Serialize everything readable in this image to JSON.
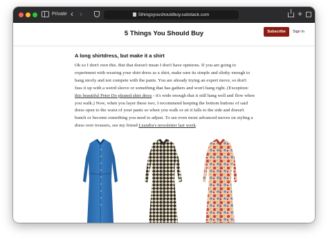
{
  "browser": {
    "private_label": "Private",
    "back_glyph": "‹",
    "forward_glyph": "›",
    "url": "5thingsyoushouldbuy.substack.com",
    "new_tab_glyph": "+"
  },
  "site": {
    "title": "5 Things You Should Buy",
    "subscribe_label": "Subscribe",
    "signin_label": "Sign in",
    "accent_color": "#8c1d10"
  },
  "article": {
    "heading": "A long shirtdress, but make it a shirt",
    "p1": "Ok so I don't own this. But that doesn't mean I don't have opinions. If you are going to experiment with wearing your shirt dress as a shirt, make sure its simple and slinky enough to hang nicely and not compete with the pants. You are already trying an expert move, so don't fuss it up with a weird sleeve or something that has gathers and won't hang right. (Exception: ",
    "link1": "this beautiful Peter Do pleated shirt dress",
    "p2": " - it's wide enough that it still hang well and flow when you walk.) Now, when you layer these two, I recommend keeping the bottom buttons of said dress open to the waist of your pants so when you walk or sit it falls to the side and doesn't bunch or become something you need to adjust. To see even more advanced moves on styling a dress over trousers, see my friend ",
    "link2": "Leandra's newsletter last week",
    "p3": "."
  },
  "products": [
    {
      "name": "blue-denim-shirtdress",
      "color": "#2f6fb0"
    },
    {
      "name": "black-cream-print-shirtdress",
      "color": "#2b2620"
    },
    {
      "name": "paisley-print-shirtdress",
      "color": "#c9463a"
    }
  ]
}
